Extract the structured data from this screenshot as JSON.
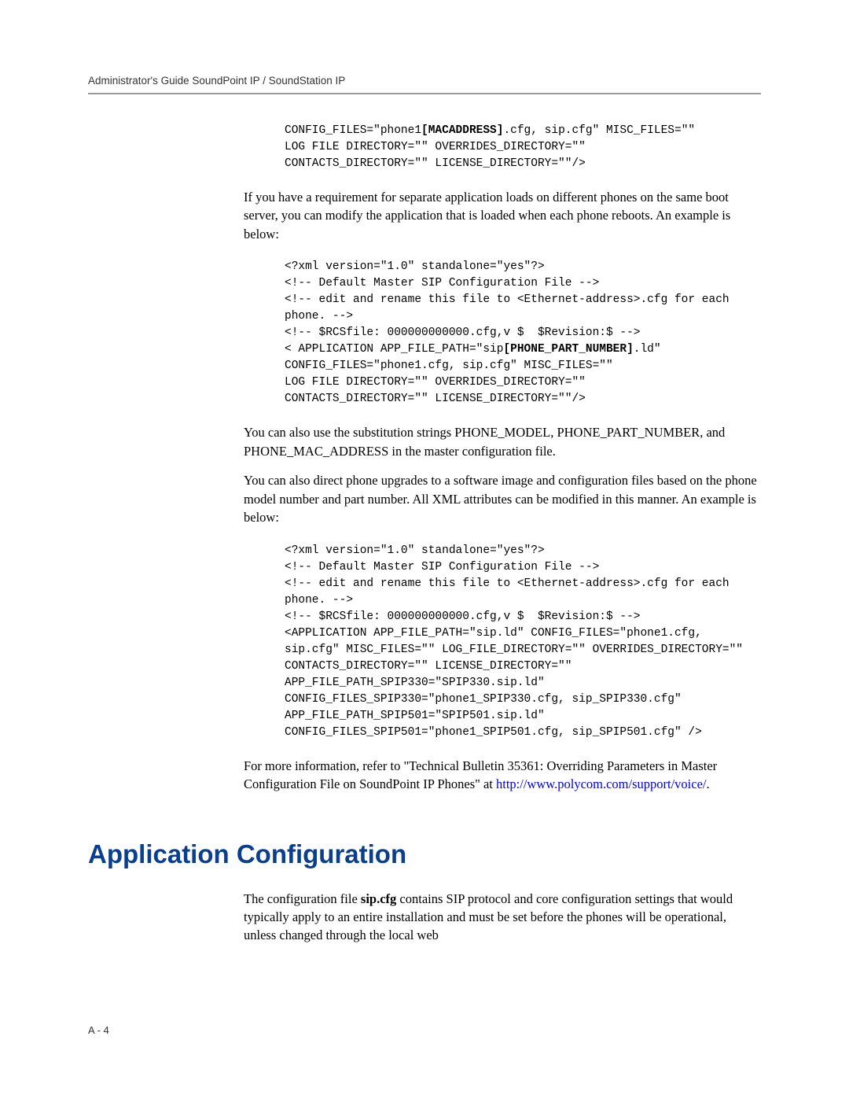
{
  "header": {
    "title": "Administrator's Guide SoundPoint IP / SoundStation IP"
  },
  "code1": {
    "line1a": "CONFIG_FILES=\"phone1",
    "line1bold": "[MACADDRESS]",
    "line1b": ".cfg, sip.cfg\" MISC_FILES=\"\"",
    "line2": "LOG FILE DIRECTORY=\"\" OVERRIDES_DIRECTORY=\"\"",
    "line3": "CONTACTS_DIRECTORY=\"\" LICENSE_DIRECTORY=\"\"/>"
  },
  "para1": "If you have a requirement for separate application loads on different phones on the same boot server, you can modify the application that is loaded when each phone reboots. An example is below:",
  "code2": {
    "line1": "<?xml version=\"1.0\" standalone=\"yes\"?>",
    "line2": "<!-- Default Master SIP Configuration File -->",
    "line3": "<!-- edit and rename this file to <Ethernet-address>.cfg for each phone. -->",
    "line4": "<!-- $RCSfile: 000000000000.cfg,v $  $Revision:$ -->",
    "line5a": "< APPLICATION APP_FILE_PATH=\"sip",
    "line5bold": "[PHONE_PART_NUMBER]",
    "line5b": ".ld\"",
    "line6": "CONFIG_FILES=\"phone1.cfg, sip.cfg\" MISC_FILES=\"\"",
    "line7": "LOG FILE DIRECTORY=\"\" OVERRIDES_DIRECTORY=\"\"",
    "line8": "CONTACTS_DIRECTORY=\"\" LICENSE_DIRECTORY=\"\"/>"
  },
  "para2": "You can also use the substitution strings PHONE_MODEL, PHONE_PART_NUMBER, and PHONE_MAC_ADDRESS in the master configuration file.",
  "para3": "You can also direct phone upgrades to a software image and configuration files based on the phone model number and part number. All XML attributes can be modified in this manner. An example is below:",
  "code3": {
    "line1": "<?xml version=\"1.0\" standalone=\"yes\"?>",
    "line2": "<!-- Default Master SIP Configuration File -->",
    "line3": "<!-- edit and rename this file to <Ethernet-address>.cfg for each phone. -->",
    "line4": "<!-- $RCSfile: 000000000000.cfg,v $  $Revision:$ -->",
    "line5": "<APPLICATION APP_FILE_PATH=\"sip.ld\" CONFIG_FILES=\"phone1.cfg, sip.cfg\" MISC_FILES=\"\" LOG_FILE_DIRECTORY=\"\" OVERRIDES_DIRECTORY=\"\"",
    "line6": "CONTACTS_DIRECTORY=\"\" LICENSE_DIRECTORY=\"\"",
    "line7": "APP_FILE_PATH_SPIP330=\"SPIP330.sip.ld\"",
    "line8": "CONFIG_FILES_SPIP330=\"phone1_SPIP330.cfg, sip_SPIP330.cfg\"",
    "line9": "APP_FILE_PATH_SPIP501=\"SPIP501.sip.ld\"",
    "line10": "CONFIG_FILES_SPIP501=\"phone1_SPIP501.cfg, sip_SPIP501.cfg\" />"
  },
  "para4a": "For more information, refer to \"Technical Bulletin 35361: Overriding Parameters in Master Configuration File on SoundPoint IP Phones\" at ",
  "para4link": "http://www.polycom.com/support/voice/",
  "para4b": ".",
  "section_title": "Application Configuration",
  "para5a": "The configuration file ",
  "para5bold": "sip.cfg",
  "para5b": " contains SIP protocol and core configuration settings that would typically apply to an entire installation and must be set before the phones will be operational, unless changed through the local web",
  "footer": "A - 4"
}
